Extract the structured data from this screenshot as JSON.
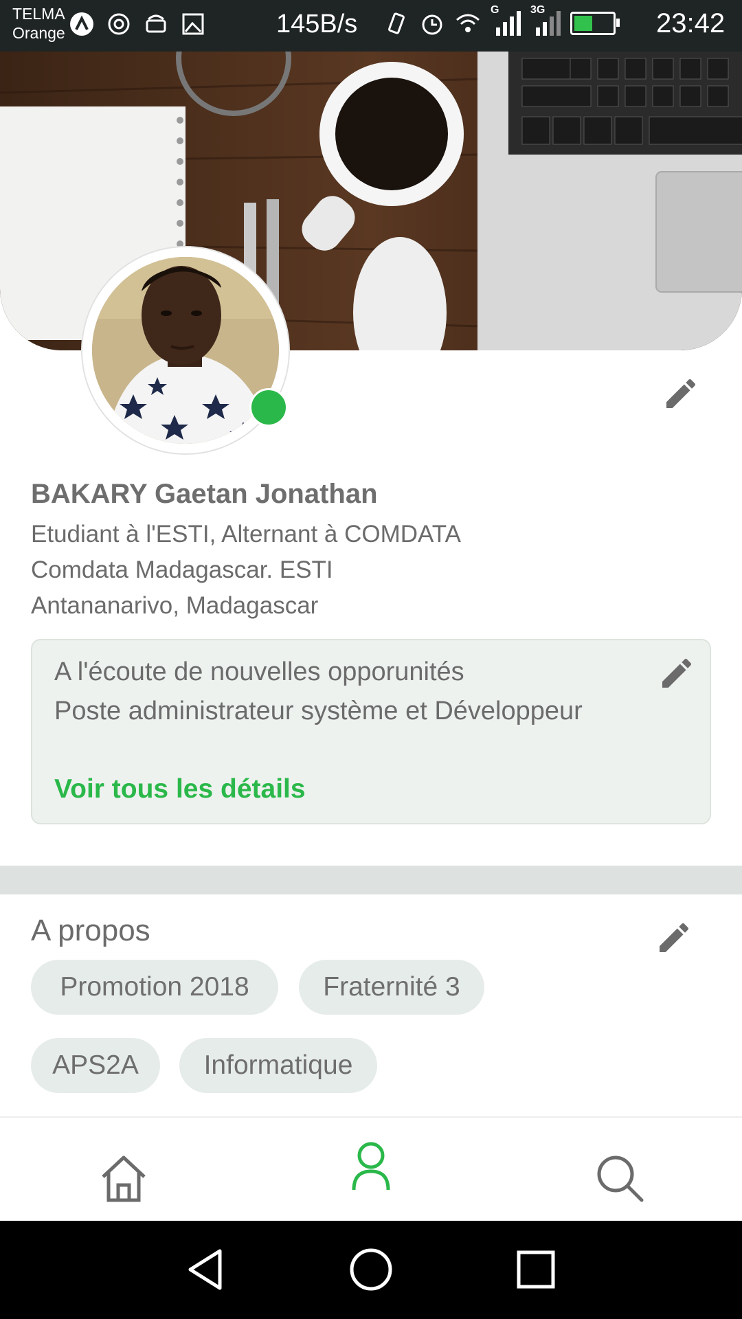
{
  "status_bar": {
    "carrier_line1": "TELMA",
    "carrier_line2": "Orange",
    "net_speed": "145B/s",
    "signal_labels": [
      "G",
      "3G"
    ],
    "time": "23:42",
    "icons": [
      "arrow-up-icon",
      "hotspot-icon",
      "android-icon",
      "image-icon",
      "vibrate-icon",
      "alarm-icon",
      "wifi-icon",
      "signal-icon",
      "battery-icon"
    ]
  },
  "profile": {
    "name": "BAKARY Gaetan Jonathan",
    "headline": "Etudiant à l'ESTI, Alternant à COMDATA",
    "companies": "Comdata Madagascar. ESTI",
    "location": "Antananarivo, Madagascar",
    "online_color": "#2bb84a"
  },
  "open_to_work": {
    "line1": "A l'écoute de nouvelles opporunités",
    "line2": "Poste administrateur système et Développeur",
    "link": "Voir tous les détails"
  },
  "about": {
    "title": "A propos",
    "chips": [
      "Promotion 2018",
      "Fraternité 3",
      "APS2A",
      "Informatique"
    ]
  },
  "bottom_nav": {
    "items": [
      "home-icon",
      "profile-icon",
      "search-icon"
    ],
    "active": "profile-icon",
    "active_color": "#2bb84a"
  },
  "system_nav": [
    "back-icon",
    "home-circle-icon",
    "recents-icon"
  ]
}
